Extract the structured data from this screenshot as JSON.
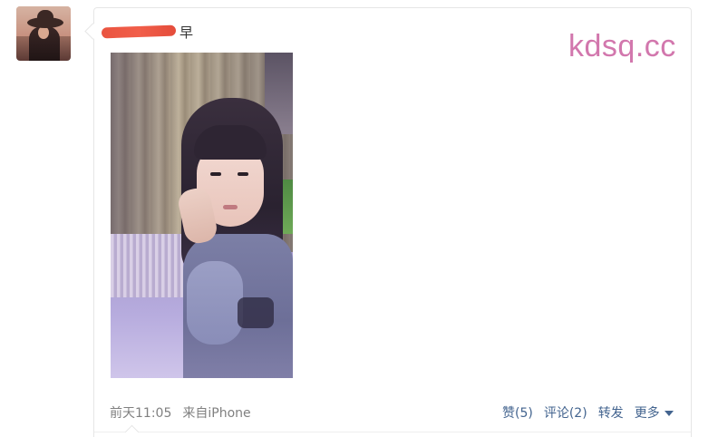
{
  "post": {
    "author_name_redacted": true,
    "text": "早",
    "watermark": "kdsq.cc",
    "timestamp": "前天11:05",
    "source": "来自iPhone"
  },
  "actions": {
    "like": "赞(5)",
    "comment": "评论(2)",
    "repost": "转发",
    "more": "更多"
  },
  "colors": {
    "link": "#43648f",
    "meta": "#808080",
    "watermark": "#d277ad",
    "redaction": "#e8452f"
  },
  "icons": {
    "more_caret": "caret-down-icon"
  }
}
